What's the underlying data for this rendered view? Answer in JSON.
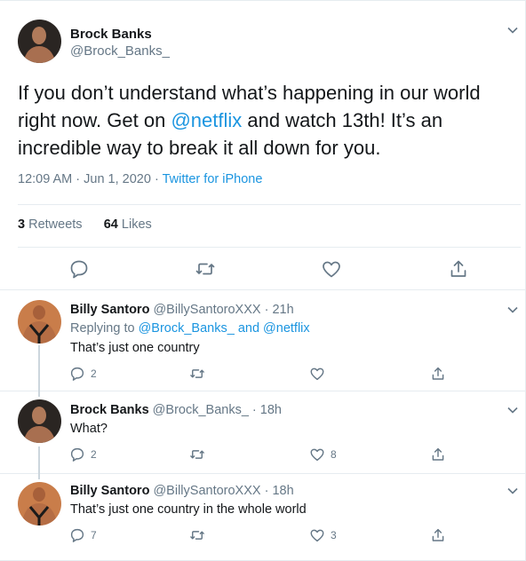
{
  "main_tweet": {
    "author_name": "Brock Banks",
    "author_handle": "@Brock_Banks_",
    "text_before": "If you don’t understand what’s happening in our world right now. Get on ",
    "mention": "@netflix",
    "text_after": " and watch 13th! It’s an incredible way to break it all down for you.",
    "timestamp": "12:09 AM · Jun 1, 2020 · ",
    "source": "Twitter for iPhone",
    "retweets_count": "3",
    "retweets_label": " Retweets",
    "likes_count": "64",
    "likes_label": " Likes"
  },
  "replies": [
    {
      "author_name": "Billy Santoro",
      "handle_time": " @BillySantoroXXX · 21h",
      "replying_prefix": "Replying to ",
      "replying_to": "@Brock_Banks_ and @netflix",
      "text": "That’s just one country",
      "reply_count": "2",
      "retweet_count": "",
      "like_count": ""
    },
    {
      "author_name": "Brock Banks",
      "handle_time": " @Brock_Banks_ · 18h",
      "text": "What?",
      "reply_count": "2",
      "retweet_count": "",
      "like_count": "8"
    },
    {
      "author_name": "Billy Santoro",
      "handle_time": " @BillySantoroXXX · 18h",
      "text": "That’s just one country in the whole world",
      "reply_count": "7",
      "retweet_count": "",
      "like_count": "3"
    }
  ],
  "icons": {
    "reply": "reply-icon",
    "retweet": "retweet-icon",
    "like": "heart-icon",
    "share": "share-icon",
    "more": "chevron-down-icon"
  },
  "colors": {
    "link": "#1b95e0",
    "secondary_text": "#657786",
    "icon": "#657786",
    "border": "#e6ecf0"
  }
}
